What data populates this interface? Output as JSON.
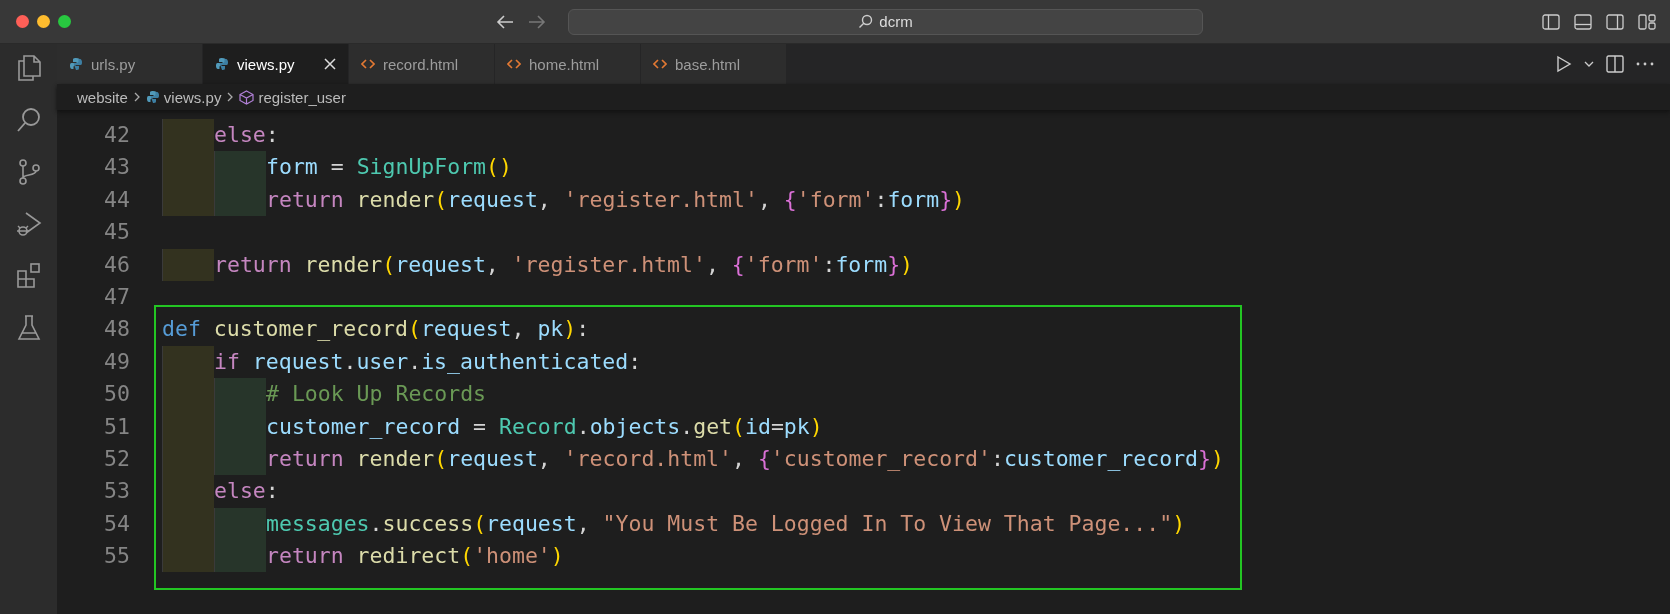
{
  "window": {
    "search": "dcrm"
  },
  "tabs": [
    {
      "label": "urls.py",
      "kind": "python",
      "selected": false
    },
    {
      "label": "views.py",
      "kind": "python",
      "selected": true
    },
    {
      "label": "record.html",
      "kind": "html",
      "selected": false
    },
    {
      "label": "home.html",
      "kind": "html",
      "selected": false
    },
    {
      "label": "base.html",
      "kind": "html",
      "selected": false
    }
  ],
  "breadcrumb": [
    {
      "label": "website",
      "kind": "folder"
    },
    {
      "label": "views.py",
      "kind": "python"
    },
    {
      "label": "register_user",
      "kind": "symbol"
    }
  ],
  "lines": [
    {
      "number": "42",
      "framed": false,
      "tokens": [
        {
          "kind": "keyword",
          "text": "    else"
        },
        {
          "kind": "punct",
          "text": ":"
        }
      ]
    },
    {
      "number": "43",
      "framed": false,
      "tokens": [
        {
          "kind": "variable",
          "text": "        form"
        },
        {
          "kind": "punct",
          "text": " = "
        },
        {
          "kind": "class",
          "text": "SignUpForm"
        },
        {
          "kind": "paren",
          "text": "()"
        }
      ]
    },
    {
      "number": "44",
      "framed": false,
      "tokens": [
        {
          "kind": "keyword",
          "text": "        return "
        },
        {
          "kind": "function",
          "text": "render"
        },
        {
          "kind": "paren",
          "text": "("
        },
        {
          "kind": "variable",
          "text": "request"
        },
        {
          "kind": "punct",
          "text": ", "
        },
        {
          "kind": "string",
          "text": "'register.html'"
        },
        {
          "kind": "punct",
          "text": ", "
        },
        {
          "kind": "brace",
          "text": "{"
        },
        {
          "kind": "string",
          "text": "'form'"
        },
        {
          "kind": "punct",
          "text": ":"
        },
        {
          "kind": "variable",
          "text": "form"
        },
        {
          "kind": "brace",
          "text": "}"
        },
        {
          "kind": "paren",
          "text": ")"
        }
      ]
    },
    {
      "number": "45",
      "framed": false
    },
    {
      "number": "46",
      "framed": false,
      "tokens": [
        {
          "kind": "keyword",
          "text": "    return "
        },
        {
          "kind": "function",
          "text": "render"
        },
        {
          "kind": "paren",
          "text": "("
        },
        {
          "kind": "variable",
          "text": "request"
        },
        {
          "kind": "punct",
          "text": ", "
        },
        {
          "kind": "string",
          "text": "'register.html'"
        },
        {
          "kind": "punct",
          "text": ", "
        },
        {
          "kind": "brace",
          "text": "{"
        },
        {
          "kind": "string",
          "text": "'form'"
        },
        {
          "kind": "punct",
          "text": ":"
        },
        {
          "kind": "variable",
          "text": "form"
        },
        {
          "kind": "brace",
          "text": "}"
        },
        {
          "kind": "paren",
          "text": ")"
        }
      ]
    },
    {
      "number": "47",
      "framed": false
    },
    {
      "number": "48",
      "framed": true,
      "tokens": [
        {
          "kind": "def",
          "text": "def "
        },
        {
          "kind": "function",
          "text": "customer_record"
        },
        {
          "kind": "paren",
          "text": "("
        },
        {
          "kind": "variable",
          "text": "request"
        },
        {
          "kind": "punct",
          "text": ", "
        },
        {
          "kind": "variable",
          "text": "pk"
        },
        {
          "kind": "paren",
          "text": ")"
        },
        {
          "kind": "punct",
          "text": ":"
        }
      ]
    },
    {
      "number": "49",
      "framed": true,
      "tokens": [
        {
          "kind": "keyword",
          "text": "    if "
        },
        {
          "kind": "variable",
          "text": "request"
        },
        {
          "kind": "punct",
          "text": "."
        },
        {
          "kind": "variable",
          "text": "user"
        },
        {
          "kind": "punct",
          "text": "."
        },
        {
          "kind": "variable",
          "text": "is_authenticated"
        },
        {
          "kind": "punct",
          "text": ":"
        }
      ]
    },
    {
      "number": "50",
      "framed": true,
      "tokens": [
        {
          "kind": "comment",
          "text": "        # Look Up Records"
        }
      ]
    },
    {
      "number": "51",
      "framed": true,
      "tokens": [
        {
          "kind": "variable",
          "text": "        customer_record"
        },
        {
          "kind": "punct",
          "text": " = "
        },
        {
          "kind": "class",
          "text": "Record"
        },
        {
          "kind": "punct",
          "text": "."
        },
        {
          "kind": "variable",
          "text": "objects"
        },
        {
          "kind": "punct",
          "text": "."
        },
        {
          "kind": "function",
          "text": "get"
        },
        {
          "kind": "paren",
          "text": "("
        },
        {
          "kind": "variable",
          "text": "id"
        },
        {
          "kind": "punct",
          "text": "="
        },
        {
          "kind": "variable",
          "text": "pk"
        },
        {
          "kind": "paren",
          "text": ")"
        }
      ]
    },
    {
      "number": "52",
      "framed": true,
      "tokens": [
        {
          "kind": "keyword",
          "text": "        return "
        },
        {
          "kind": "function",
          "text": "render"
        },
        {
          "kind": "paren",
          "text": "("
        },
        {
          "kind": "variable",
          "text": "request"
        },
        {
          "kind": "punct",
          "text": ", "
        },
        {
          "kind": "string",
          "text": "'record.html'"
        },
        {
          "kind": "punct",
          "text": ", "
        },
        {
          "kind": "brace",
          "text": "{"
        },
        {
          "kind": "string",
          "text": "'customer_record'"
        },
        {
          "kind": "punct",
          "text": ":"
        },
        {
          "kind": "variable",
          "text": "customer_record"
        },
        {
          "kind": "brace",
          "text": "}"
        },
        {
          "kind": "paren",
          "text": ")"
        }
      ]
    },
    {
      "number": "53",
      "framed": true,
      "tokens": [
        {
          "kind": "keyword",
          "text": "    else"
        },
        {
          "kind": "punct",
          "text": ":"
        }
      ]
    },
    {
      "number": "54",
      "framed": true,
      "tokens": [
        {
          "kind": "class",
          "text": "        messages"
        },
        {
          "kind": "punct",
          "text": "."
        },
        {
          "kind": "function",
          "text": "success"
        },
        {
          "kind": "paren",
          "text": "("
        },
        {
          "kind": "variable",
          "text": "request"
        },
        {
          "kind": "punct",
          "text": ", "
        },
        {
          "kind": "string",
          "text": "\"You Must Be Logged In To View That Page...\""
        },
        {
          "kind": "paren",
          "text": ")"
        }
      ]
    },
    {
      "number": "55",
      "framed": true,
      "tokens": [
        {
          "kind": "keyword",
          "text": "        return "
        },
        {
          "kind": "function",
          "text": "redirect"
        },
        {
          "kind": "paren",
          "text": "("
        },
        {
          "kind": "string",
          "text": "'home'"
        },
        {
          "kind": "paren",
          "text": ")"
        }
      ]
    }
  ]
}
